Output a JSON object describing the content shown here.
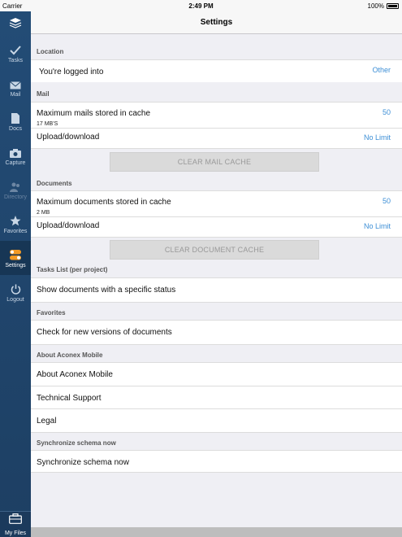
{
  "status": {
    "carrier": "Carrier",
    "time": "2:49 PM",
    "battery": "100%"
  },
  "navbar": {
    "title": "Settings"
  },
  "sidebar": {
    "items": [
      {
        "label": "Tasks",
        "icon": "check-icon"
      },
      {
        "label": "Mail",
        "icon": "mail-icon"
      },
      {
        "label": "Docs",
        "icon": "document-icon"
      },
      {
        "label": "Capture",
        "icon": "camera-icon"
      },
      {
        "label": "Directory",
        "icon": "people-icon"
      },
      {
        "label": "Favorites",
        "icon": "star-icon"
      },
      {
        "label": "Settings",
        "icon": "settings-toggle-icon"
      },
      {
        "label": "Logout",
        "icon": "power-icon"
      }
    ],
    "my_files": "My Files"
  },
  "sections": {
    "location": {
      "header": "Location",
      "logged_into": "You're logged into",
      "logged_into_value": "Other"
    },
    "mail": {
      "header": "Mail",
      "max_mails": "Maximum mails stored in cache",
      "max_mails_value": "50",
      "max_mails_sub": "17 MB'S",
      "upload_download": "Upload/download",
      "upload_download_value": "No Limit",
      "clear_button": "CLEAR MAIL CACHE"
    },
    "documents": {
      "header": "Documents",
      "max_docs": "Maximum documents stored in cache",
      "max_docs_value": "50",
      "max_docs_sub": "2 MB",
      "upload_download": "Upload/download",
      "upload_download_value": "No Limit",
      "clear_button": "CLEAR DOCUMENT CACHE"
    },
    "tasks": {
      "header": "Tasks List (per project)",
      "show_docs": "Show documents with a specific status"
    },
    "favorites": {
      "header": "Favorites",
      "check_versions": "Check for new versions of documents"
    },
    "about": {
      "header": "About Aconex Mobile",
      "about": "About Aconex Mobile",
      "support": "Technical Support",
      "legal": "Legal"
    },
    "sync": {
      "header": "Synchronize schema now",
      "sync": "Synchronize schema now"
    }
  },
  "colors": {
    "sidebar": "#234c76",
    "accent": "#3d8fd6",
    "background": "#efeff4"
  }
}
